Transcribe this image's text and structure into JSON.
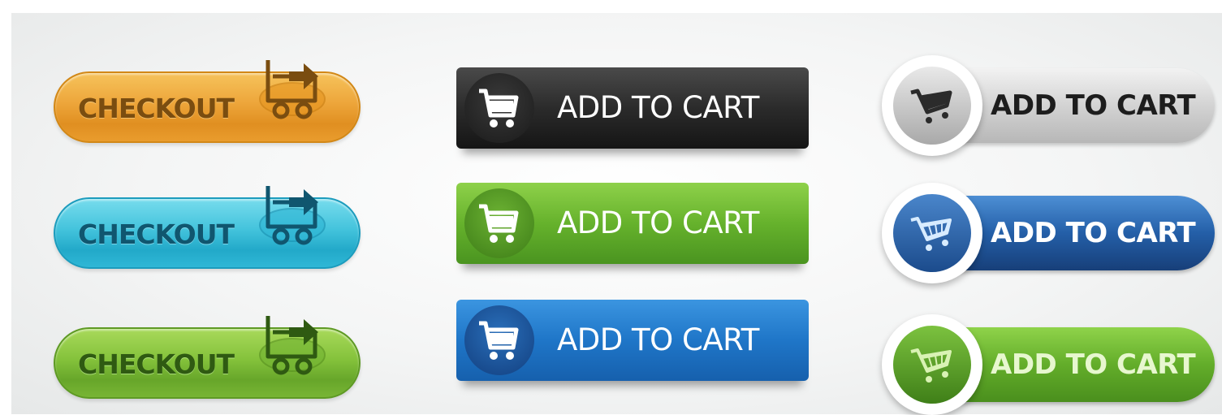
{
  "checkout_buttons": [
    {
      "label": "CHECKOUT",
      "style": "orange",
      "color": "#eda53a"
    },
    {
      "label": "CHECKOUT",
      "style": "cyan",
      "color": "#43c3dc"
    },
    {
      "label": "CHECKOUT",
      "style": "green",
      "color": "#84c23b"
    }
  ],
  "rect_cart_buttons": [
    {
      "label": "ADD TO CART",
      "style": "black",
      "color": "#2b2b2b",
      "icon": "shopping-cart-icon"
    },
    {
      "label": "ADD TO CART",
      "style": "green",
      "color": "#66b22c",
      "icon": "shopping-cart-icon"
    },
    {
      "label": "ADD TO CART",
      "style": "blue",
      "color": "#1f76c8",
      "icon": "shopping-cart-icon"
    }
  ],
  "round_cart_buttons": [
    {
      "label": "ADD TO CART",
      "style": "silver",
      "color": "#d3d3d3",
      "icon": "shopping-cart-icon"
    },
    {
      "label": "ADD TO CART",
      "style": "blue",
      "color": "#245fa8",
      "icon": "shopping-cart-icon"
    },
    {
      "label": "ADD TO CART",
      "style": "green",
      "color": "#63ad2a",
      "icon": "shopping-cart-icon"
    }
  ]
}
